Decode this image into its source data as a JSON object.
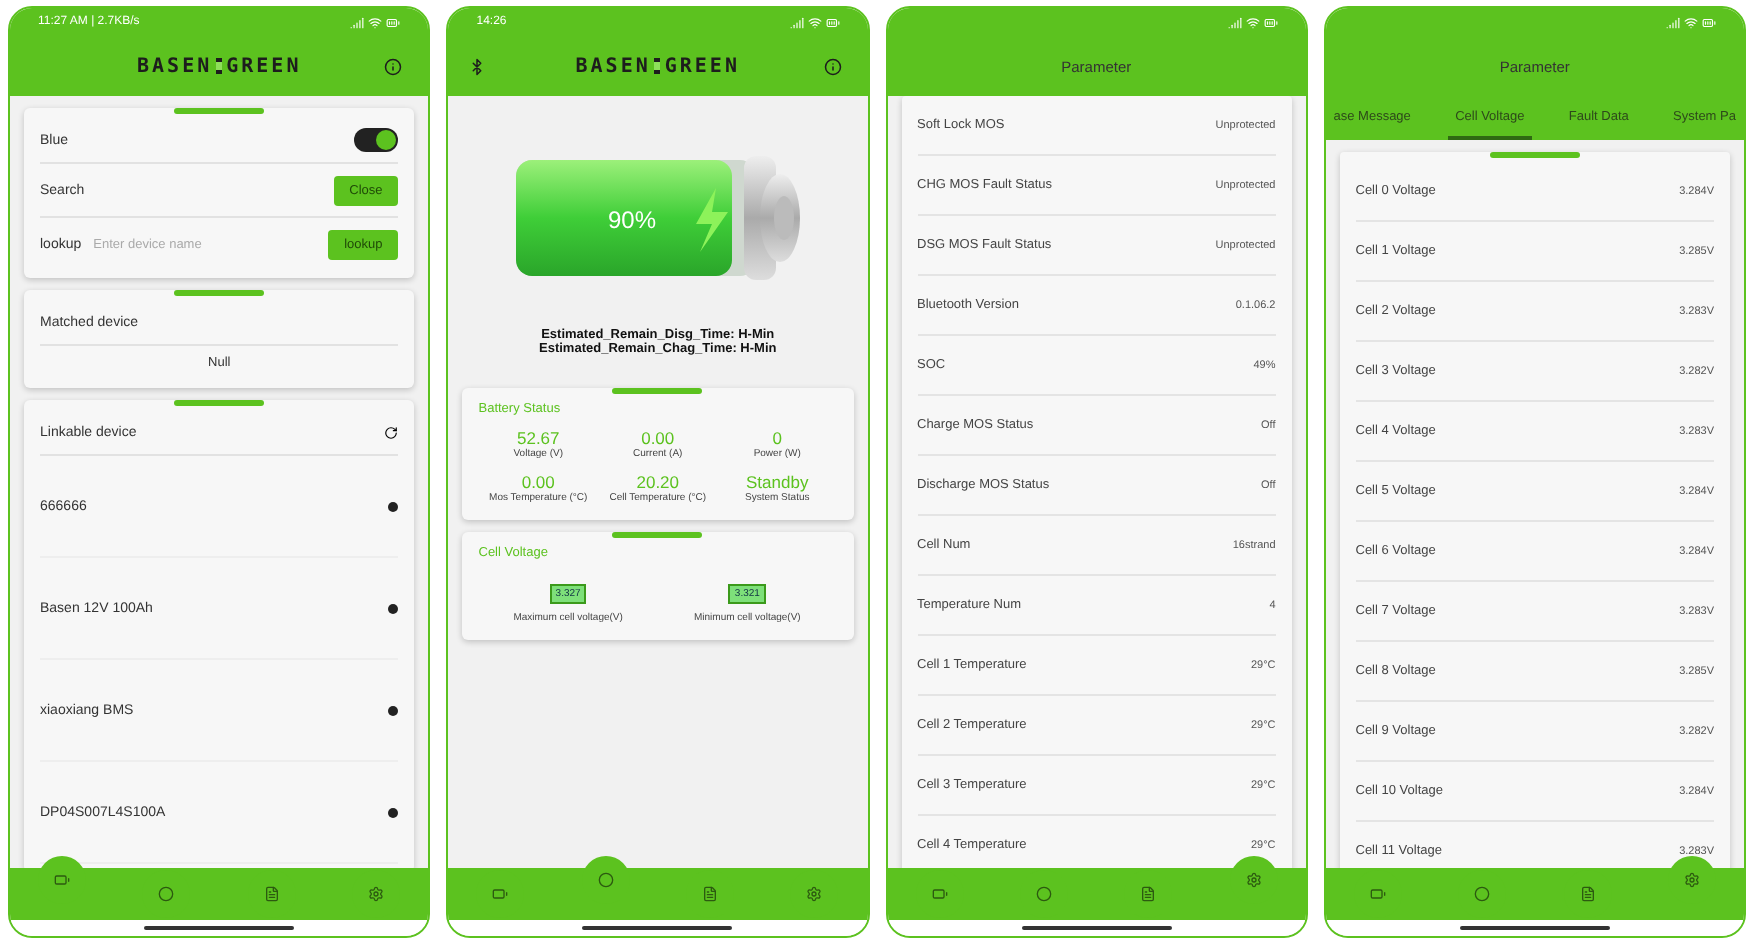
{
  "phones": [
    {
      "kind": "connect",
      "status_time": "11:27 AM | 2.7KB/s",
      "header": {
        "logo_left": "BASEN",
        "logo_right": "GREEN"
      },
      "settings_card": {
        "blue_label": "Blue",
        "blue_on": true,
        "search_label": "Search",
        "search_button": "Close",
        "lookup_label": "lookup",
        "lookup_placeholder": "Enter device name",
        "lookup_button": "lookup"
      },
      "matched": {
        "title": "Matched device",
        "value": "Null"
      },
      "linkable": {
        "title": "Linkable device",
        "devices": [
          {
            "name": "666666"
          },
          {
            "name": "Basen 12V 100Ah"
          },
          {
            "name": "xiaoxiang BMS"
          },
          {
            "name": "DP04S007L4S100A"
          }
        ]
      },
      "nav": [
        {
          "selected": true
        },
        {
          "selected": false
        },
        {
          "selected": false
        },
        {
          "selected": false
        }
      ]
    },
    {
      "kind": "home",
      "status_time": "14:26",
      "header": {
        "logo_left": "BASEN",
        "logo_right": "GREEN",
        "bluetooth_icon": true
      },
      "battery": {
        "percent": "90%",
        "level": 0.9
      },
      "times": [
        "Estimated_Remain_Disg_Time: H-Min",
        "Estimated_Remain_Chag_Time: H-Min"
      ],
      "battery_status": {
        "title": "Battery Status",
        "metrics": [
          {
            "value": "52.67",
            "label": "Voltage  (V)"
          },
          {
            "value": "0.00",
            "label": "Current  (A)"
          },
          {
            "value": "0",
            "label": "Power  (W)"
          },
          {
            "value": "0.00",
            "label": "Mos Temperature (°C)"
          },
          {
            "value": "20.20",
            "label": "Cell Temperature (°C)"
          },
          {
            "value": "Standby",
            "label": "System Status"
          }
        ]
      },
      "cell_voltage": {
        "title": "Cell Voltage",
        "items": [
          {
            "value": "3.327",
            "label": "Maximum cell voltage(V)"
          },
          {
            "value": "3.321",
            "label": "Minimum cell voltage(V)"
          }
        ]
      },
      "nav": [
        {
          "selected": false
        },
        {
          "selected": true
        },
        {
          "selected": false
        },
        {
          "selected": false
        }
      ]
    },
    {
      "kind": "parameters",
      "title": "Parameter",
      "rows": [
        {
          "name": "Soft Lock MOS",
          "value": "Unprotected"
        },
        {
          "name": "CHG MOS Fault Status",
          "value": "Unprotected"
        },
        {
          "name": "DSG MOS Fault Status",
          "value": "Unprotected"
        },
        {
          "name": "Bluetooth Version",
          "value": "0.1.06.2"
        },
        {
          "name": "SOC",
          "value": "49%"
        },
        {
          "name": "Charge MOS Status",
          "value": "Off"
        },
        {
          "name": "Discharge MOS Status",
          "value": "Off"
        },
        {
          "name": "Cell Num",
          "value": "16strand"
        },
        {
          "name": "Temperature Num",
          "value": "4"
        },
        {
          "name": "Cell 1 Temperature",
          "value": "29°C"
        },
        {
          "name": "Cell 2 Temperature",
          "value": "29°C"
        },
        {
          "name": "Cell 3 Temperature",
          "value": "29°C"
        },
        {
          "name": "Cell 4 Temperature",
          "value": "29°C"
        }
      ],
      "nav": [
        {
          "selected": false
        },
        {
          "selected": false
        },
        {
          "selected": false
        },
        {
          "selected": true
        }
      ]
    },
    {
      "kind": "parameters",
      "title": "Parameter",
      "tabs": [
        {
          "label": "ase Message",
          "selected": false
        },
        {
          "label": "Cell Voltage",
          "selected": true
        },
        {
          "label": "Fault Data",
          "selected": false
        },
        {
          "label": "System Pa",
          "selected": false
        }
      ],
      "rows": [
        {
          "name": "Cell 0 Voltage",
          "value": "3.284V"
        },
        {
          "name": "Cell 1 Voltage",
          "value": "3.285V"
        },
        {
          "name": "Cell 2 Voltage",
          "value": "3.283V"
        },
        {
          "name": "Cell 3 Voltage",
          "value": "3.282V"
        },
        {
          "name": "Cell 4 Voltage",
          "value": "3.283V"
        },
        {
          "name": "Cell 5 Voltage",
          "value": "3.284V"
        },
        {
          "name": "Cell 6 Voltage",
          "value": "3.284V"
        },
        {
          "name": "Cell 7 Voltage",
          "value": "3.283V"
        },
        {
          "name": "Cell 8 Voltage",
          "value": "3.285V"
        },
        {
          "name": "Cell 9 Voltage",
          "value": "3.282V"
        },
        {
          "name": "Cell 10 Voltage",
          "value": "3.284V"
        },
        {
          "name": "Cell 11 Voltage",
          "value": "3.283V"
        }
      ],
      "nav": [
        {
          "selected": false
        },
        {
          "selected": false
        },
        {
          "selected": false
        },
        {
          "selected": true
        }
      ]
    }
  ]
}
